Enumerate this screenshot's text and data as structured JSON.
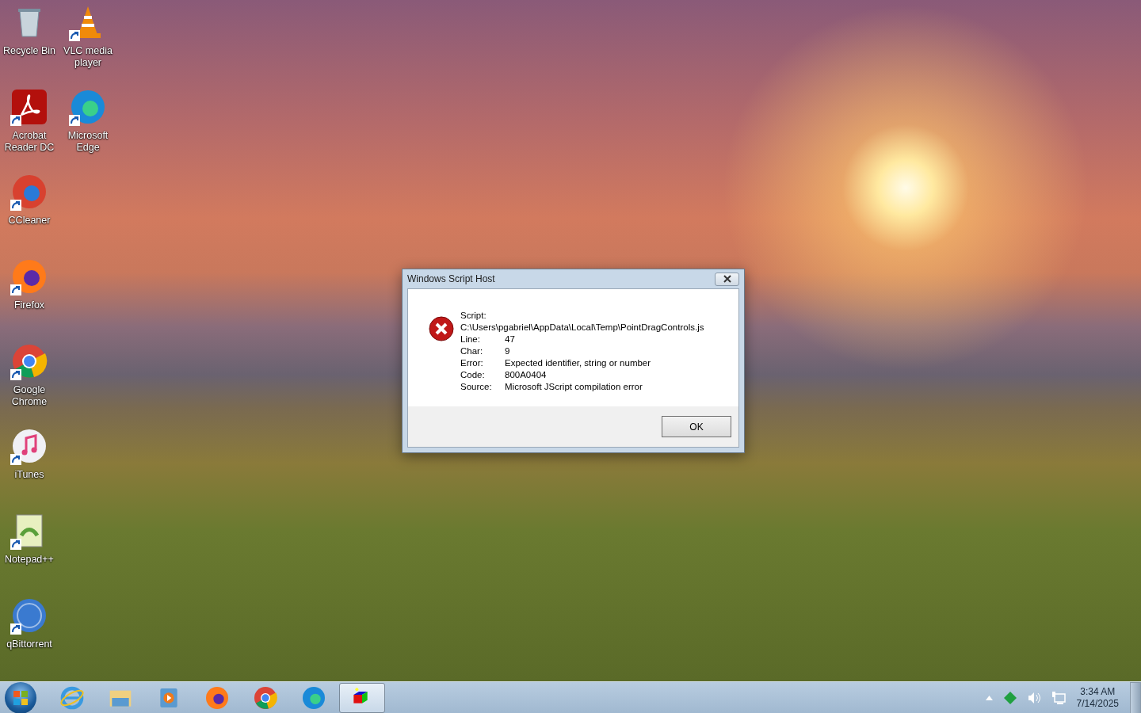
{
  "desktop": {
    "columns": [
      [
        {
          "label": "Recycle Bin",
          "kind": "bin",
          "shortcut": false
        },
        {
          "label": "Acrobat Reader DC",
          "kind": "acrobat",
          "shortcut": true
        },
        {
          "label": "CCleaner",
          "kind": "ccleaner",
          "shortcut": true
        },
        {
          "label": "Firefox",
          "kind": "firefox",
          "shortcut": true
        },
        {
          "label": "Google Chrome",
          "kind": "chrome",
          "shortcut": true
        },
        {
          "label": "iTunes",
          "kind": "itunes",
          "shortcut": true
        },
        {
          "label": "Notepad++",
          "kind": "notepad",
          "shortcut": true
        },
        {
          "label": "qBittorrent",
          "kind": "qbittorrent",
          "shortcut": true
        }
      ],
      [
        {
          "label": "VLC media player",
          "kind": "vlc",
          "shortcut": true
        },
        {
          "label": "Microsoft Edge",
          "kind": "edge",
          "shortcut": true
        }
      ]
    ]
  },
  "dialog": {
    "title": "Windows Script Host",
    "script_label": "Script:",
    "script_path": "C:\\Users\\pgabriel\\AppData\\Local\\Temp\\PointDragControls.js",
    "fields": [
      {
        "label": "Line:",
        "value": "47"
      },
      {
        "label": "Char:",
        "value": "9"
      },
      {
        "label": "Error:",
        "value": "Expected identifier, string or number"
      },
      {
        "label": "Code:",
        "value": "800A0404"
      },
      {
        "label": "Source:",
        "value": "Microsoft JScript compilation error"
      }
    ],
    "button": "OK"
  },
  "taskbar": {
    "apps": [
      {
        "kind": "ie",
        "selected": false
      },
      {
        "kind": "explorer",
        "selected": false
      },
      {
        "kind": "mediaplayer",
        "selected": false
      },
      {
        "kind": "firefox",
        "selected": false
      },
      {
        "kind": "chrome",
        "selected": false
      },
      {
        "kind": "edge",
        "selected": false
      },
      {
        "kind": "cube",
        "selected": true
      }
    ],
    "clock": {
      "time": "3:34 AM",
      "date": "7/14/2025"
    }
  }
}
